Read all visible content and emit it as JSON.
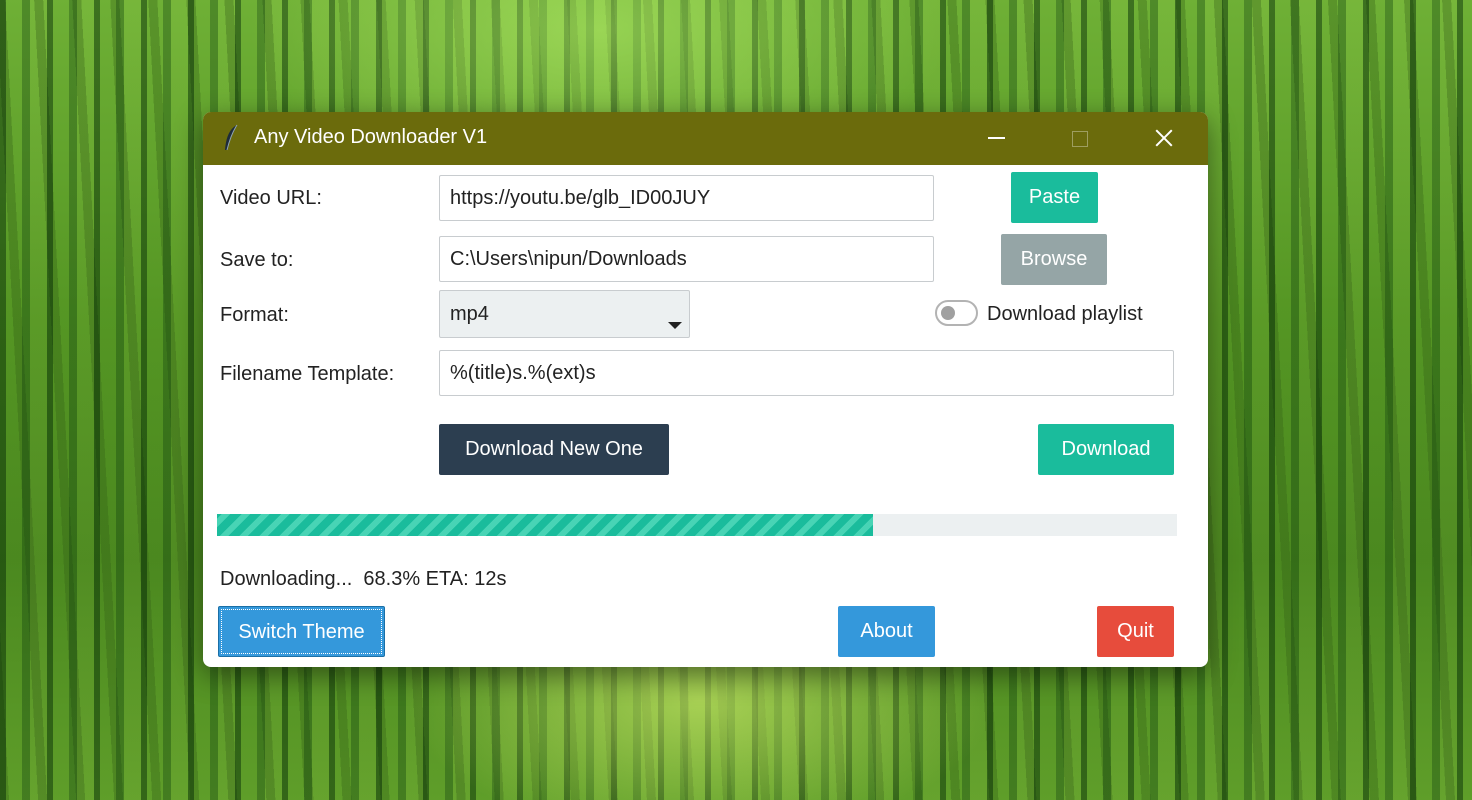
{
  "window": {
    "title": "Any Video Downloader V1",
    "controls": {
      "minimize": "minimize-icon",
      "maximize": "maximize-icon",
      "close": "close-icon"
    }
  },
  "form": {
    "url_label": "Video URL:",
    "url_value": "https://youtu.be/glb_ID00JUY",
    "paste_label": "Paste",
    "save_label": "Save to:",
    "save_value": "C:\\Users\\nipun/Downloads",
    "browse_label": "Browse",
    "format_label": "Format:",
    "format_value": "mp4",
    "playlist_label": "Download playlist",
    "playlist_enabled": false,
    "template_label": "Filename Template:",
    "template_value": "%(title)s.%(ext)s",
    "download_new_label": "Download New One",
    "download_label": "Download"
  },
  "progress": {
    "percent": 68.3,
    "status_text": "Downloading...  68.3% ETA: 12s"
  },
  "footer": {
    "switch_theme_label": "Switch Theme",
    "about_label": "About",
    "quit_label": "Quit"
  },
  "colors": {
    "titlebar": "#6b6b0c",
    "teal": "#1abc9c",
    "gray": "#95a5a6",
    "dark": "#2c3e50",
    "blue": "#3498db",
    "red": "#e74c3c"
  }
}
